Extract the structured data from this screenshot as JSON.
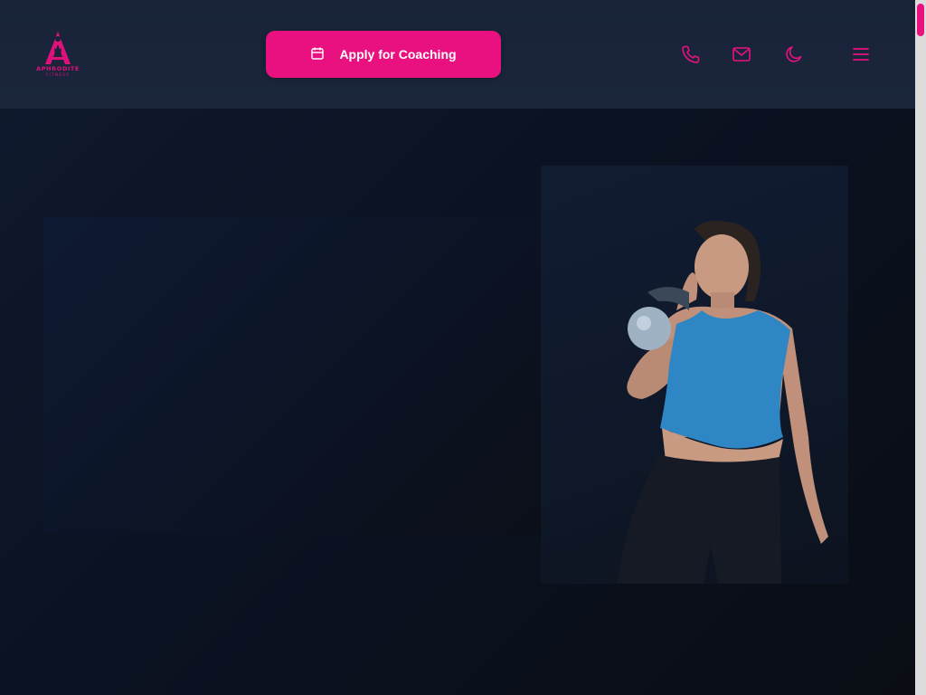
{
  "brand": {
    "name": "APHRODITE",
    "tagline": "FITNESS",
    "accent_color": "#e8117f"
  },
  "header": {
    "cta_label": "Apply for Coaching",
    "cta_icon": "calendar-icon",
    "icons": [
      "phone-icon",
      "mail-icon",
      "moon-icon",
      "menu-icon"
    ]
  },
  "hero": {
    "image": "woman-holding-kettlebell-photo"
  }
}
